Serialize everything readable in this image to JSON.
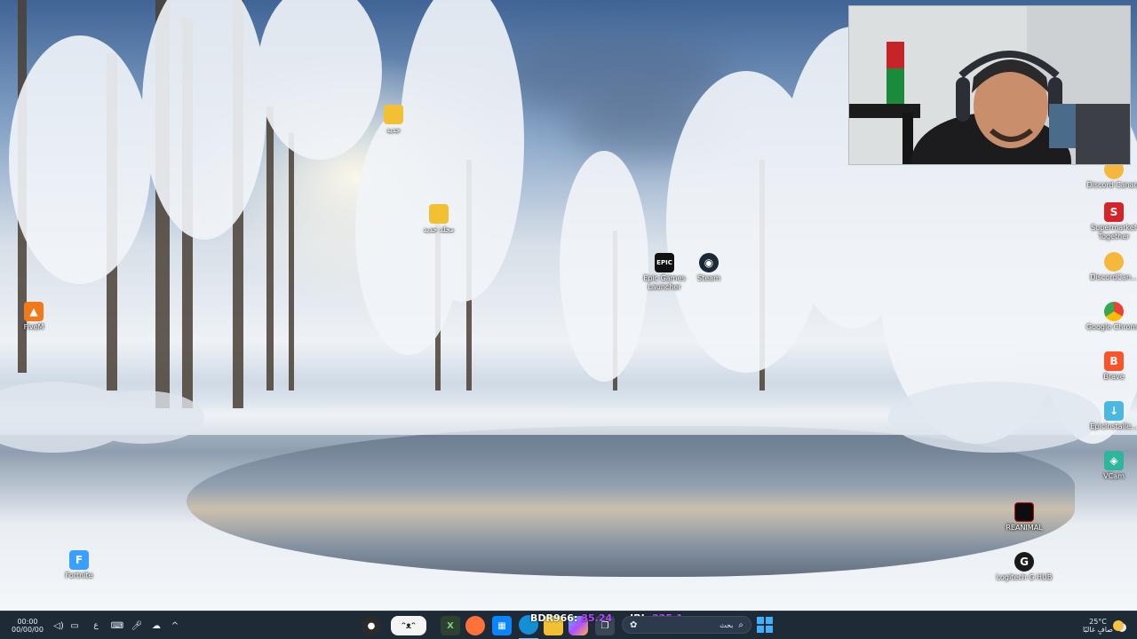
{
  "desktop": {
    "left_icons": [
      {
        "name": "folder-1",
        "label": "جديد"
      },
      {
        "name": "folder-2",
        "label": "مجلد جديد"
      },
      {
        "name": "fivem",
        "label": "FiveM"
      },
      {
        "name": "fortnite",
        "label": "Fortnite"
      }
    ],
    "middle_icons": [
      {
        "name": "epic",
        "label": "Epic Games Launcher",
        "glyph": "EPIC"
      },
      {
        "name": "steam",
        "label": "Steam"
      }
    ],
    "right_icons": [
      {
        "name": "discord-canary",
        "label": "Discord Canary"
      },
      {
        "name": "supermarket-together",
        "label": "Supermarket Together",
        "glyph": "S"
      },
      {
        "name": "discordcan",
        "label": "DiscordCan..."
      },
      {
        "name": "google-chrome",
        "label": "Google Chrome"
      },
      {
        "name": "brave",
        "label": "Brave"
      },
      {
        "name": "epicinstaller",
        "label": "EpicInstalle..."
      },
      {
        "name": "vcam",
        "label": "VCam"
      },
      {
        "name": "reanimal",
        "label": "REANIMAL"
      },
      {
        "name": "logitech",
        "label": "Logitech G HUB"
      }
    ]
  },
  "taskbar": {
    "clock_time": "00:00",
    "clock_date": "00/00/00",
    "lang": "ع",
    "ticker": {
      "bdr_label": "BDR966:",
      "bdr_value": "35.24",
      "jbl_label": "JBI:",
      "jbl_value": "225.1"
    },
    "search_placeholder": "بحث",
    "weather_temp": "25°C",
    "weather_desc": "صافٍ غالبًا"
  },
  "colors": {
    "taskbar_bg": "#1f2a37",
    "ticker_value": "#b14cff",
    "accent_blue": "#0a84ff"
  }
}
